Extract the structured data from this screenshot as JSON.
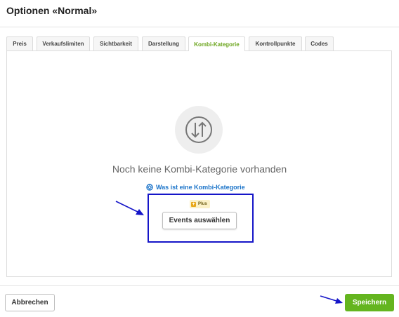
{
  "header": {
    "title": "Optionen «Normal»"
  },
  "tabs": [
    {
      "label": "Preis",
      "active": false
    },
    {
      "label": "Verkaufslimiten",
      "active": false
    },
    {
      "label": "Sichtbarkeit",
      "active": false
    },
    {
      "label": "Darstellung",
      "active": false
    },
    {
      "label": "Kombi-Kategorie",
      "active": true
    },
    {
      "label": "Kontrollpunkte",
      "active": false
    },
    {
      "label": "Codes",
      "active": false
    }
  ],
  "empty_state": {
    "icon": "sort-arrows-icon",
    "message": "Noch keine Kombi-Kategorie vorhanden",
    "help_link": "Was ist eine Kombi-Kategorie",
    "help_icon": "lifebuoy-icon",
    "badge": "Plus",
    "action_label": "Events auswählen"
  },
  "footer": {
    "cancel_label": "Abbrechen",
    "save_label": "Speichern"
  },
  "colors": {
    "accent_green": "#64b51f",
    "active_tab_text": "#6aa41b",
    "link_blue": "#1a73c9",
    "annotation_blue": "#1515c8"
  }
}
